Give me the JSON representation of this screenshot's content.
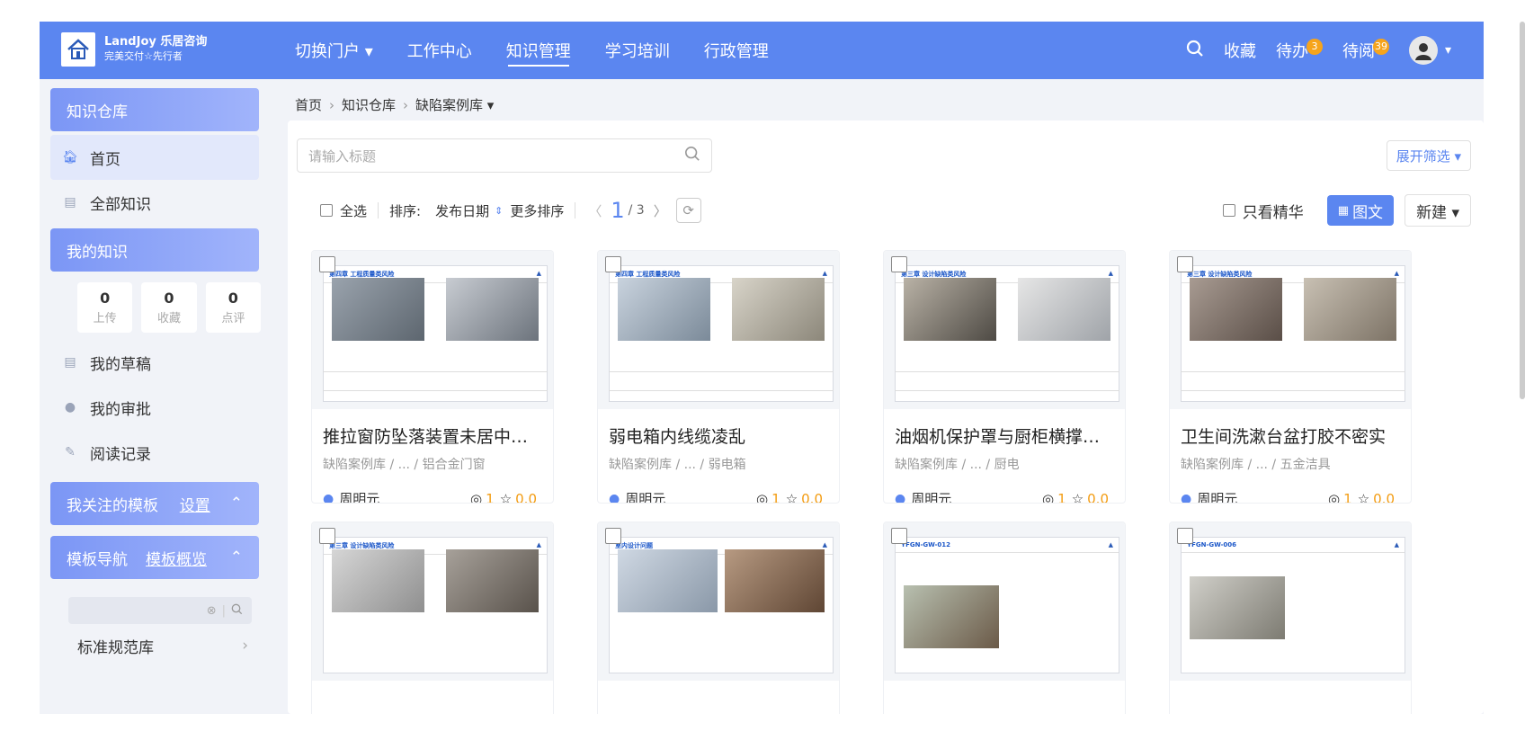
{
  "app": {
    "logo_name": "LandJoy 乐居咨询",
    "logo_tagline": "完美交付☆先行者"
  },
  "nav": {
    "items": [
      {
        "label": "切换门户 ▾"
      },
      {
        "label": "工作中心"
      },
      {
        "label": "知识管理"
      },
      {
        "label": "学习培训"
      },
      {
        "label": "行政管理"
      }
    ],
    "favorites": "收藏",
    "todo": "待办",
    "todo_count": "3",
    "toread": "待阅",
    "toread_count": "39",
    "avatar_caret": "▾"
  },
  "sidebar": {
    "header_repo": "知识仓库",
    "home": "首页",
    "all_knowledge": "全部知识",
    "header_mine": "我的知识",
    "stats": [
      {
        "value": "0",
        "label": "上传"
      },
      {
        "value": "0",
        "label": "收藏"
      },
      {
        "value": "0",
        "label": "点评"
      }
    ],
    "drafts": "我的草稿",
    "approvals": "我的审批",
    "reading": "阅读记录",
    "followed_templates": "我关注的模板",
    "followed_link": "设置",
    "template_nav": "模板导航",
    "template_link": "模板概览",
    "library": "标准规范库"
  },
  "breadcrumb": {
    "home": "首页",
    "repo": "知识仓库",
    "current": "缺陷案例库 ▾"
  },
  "search": {
    "placeholder": "请输入标题"
  },
  "filter_toggle": "展开筛选 ▾",
  "toolbar": {
    "select_all": "全选",
    "sort_label": "排序:",
    "sort_field": "发布日期",
    "more_sort": "更多排序",
    "page_current": "1",
    "page_total": "/ 3",
    "only_featured": "只看精华",
    "view_mode": "图文",
    "new_button": "新建 ▾"
  },
  "cards": [
    {
      "title": "推拉窗防坠落装置未居中固…",
      "path": "缺陷案例库 / ... / 铝合金门窗",
      "author": "周明元",
      "views": "1",
      "rating": "0.0",
      "doc_header": "第四章 工程质量类风险"
    },
    {
      "title": "弱电箱内线缆凌乱",
      "path": "缺陷案例库 / ... / 弱电箱",
      "author": "周明元",
      "views": "1",
      "rating": "0.0",
      "doc_header": "第四章 工程质量类风险"
    },
    {
      "title": "油烟机保护罩与厨柜横撑冲突",
      "path": "缺陷案例库 / ... / 厨电",
      "author": "周明元",
      "views": "1",
      "rating": "0.0",
      "doc_header": "第三章 设计缺陷类风险"
    },
    {
      "title": "卫生间洗漱台盆打胶不密实",
      "path": "缺陷案例库 / ... / 五金洁具",
      "author": "周明元",
      "views": "1",
      "rating": "0.0",
      "doc_header": "第三章 设计缺陷类风险"
    },
    {
      "title": "",
      "path": "",
      "author": "",
      "views": "",
      "rating": "",
      "doc_header": "第三章 设计缺陷类风险"
    },
    {
      "title": "",
      "path": "",
      "author": "",
      "views": "",
      "rating": "",
      "doc_header": "室内设计问题"
    },
    {
      "title": "",
      "path": "",
      "author": "",
      "views": "",
      "rating": "",
      "doc_header": "YFGN-GW-012"
    },
    {
      "title": "",
      "path": "",
      "author": "",
      "views": "",
      "rating": "",
      "doc_header": "YFGN-GW-006"
    }
  ]
}
